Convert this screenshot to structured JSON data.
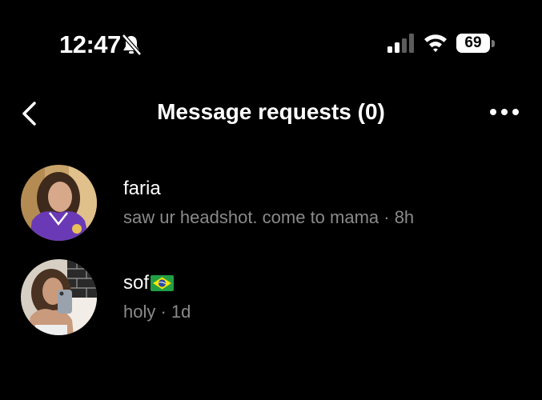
{
  "status_bar": {
    "time": "12:47",
    "battery_level": "69",
    "icons": [
      "bell-slash-icon",
      "cellular-signal-icon",
      "wifi-icon",
      "battery-icon"
    ]
  },
  "header": {
    "title": "Message requests (0)",
    "back_icon": "chevron-left-icon",
    "more_icon": "ellipsis-icon"
  },
  "requests": [
    {
      "name": "faria",
      "preview": "saw ur headshot. come to mama · 8h"
    },
    {
      "name": "sof",
      "name_flag": "brazil-flag-icon",
      "preview": "holy · 1d"
    }
  ],
  "colors": {
    "background": "#000000",
    "text_primary": "#ffffff",
    "text_secondary": "#8a8a8a"
  }
}
